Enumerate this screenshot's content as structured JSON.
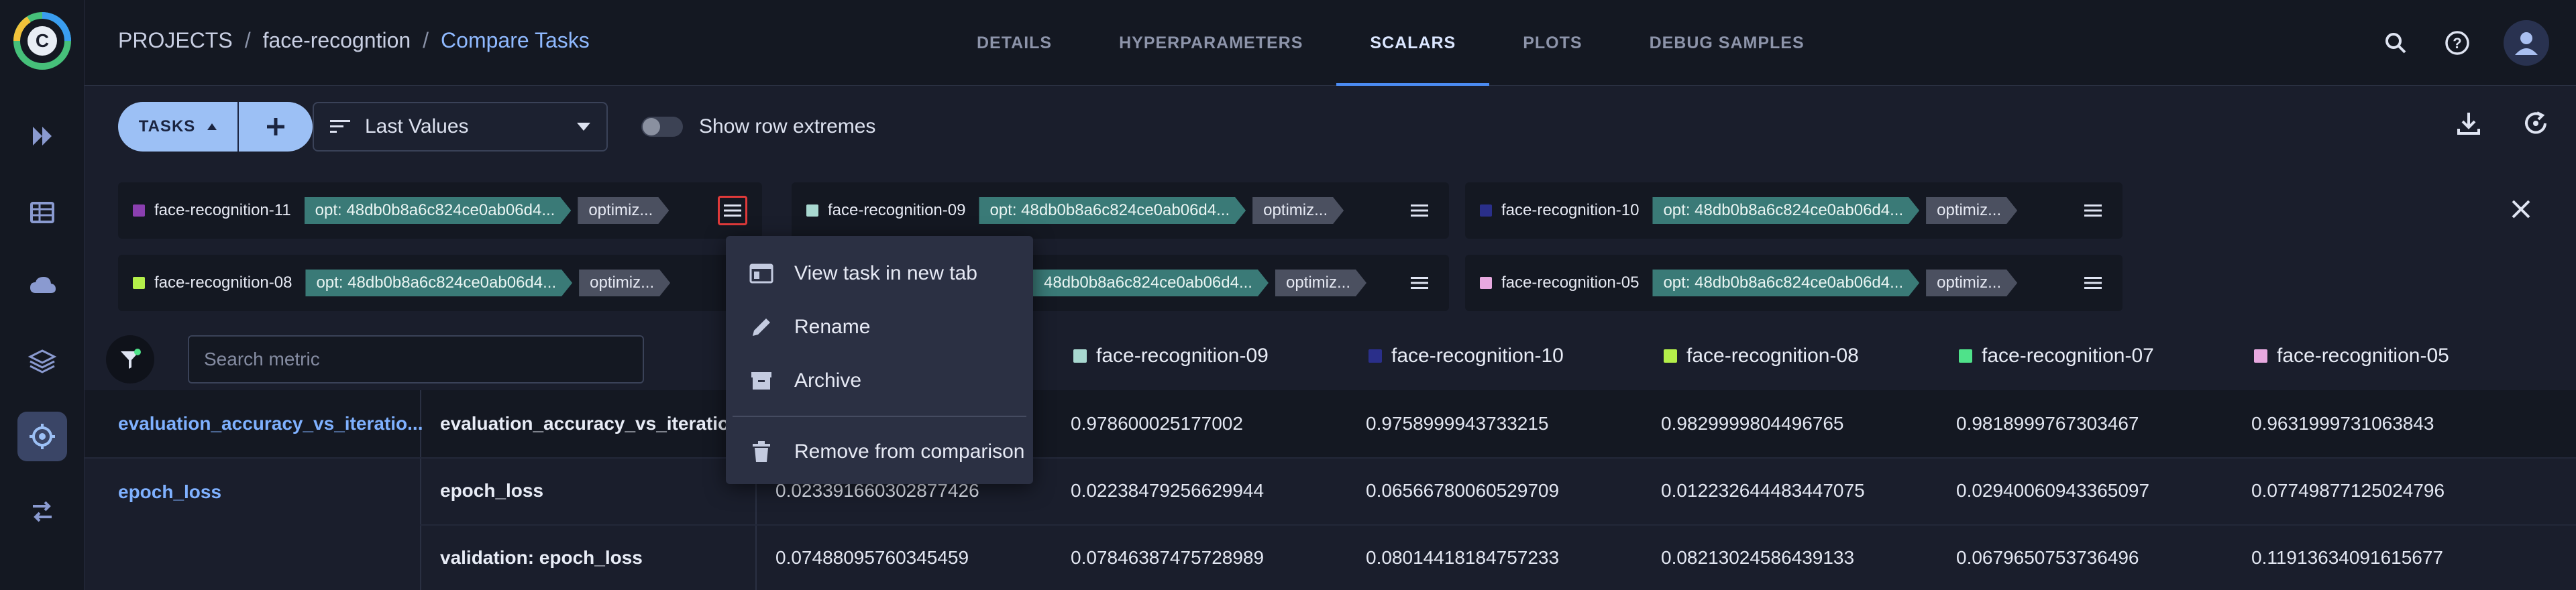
{
  "breadcrumb": {
    "projects": "PROJECTS",
    "project": "face-recogntion",
    "current": "Compare Tasks",
    "sep": "/"
  },
  "tabs": [
    {
      "label": "DETAILS",
      "active": false
    },
    {
      "label": "HYPERPARAMETERS",
      "active": false
    },
    {
      "label": "SCALARS",
      "active": true
    },
    {
      "label": "PLOTS",
      "active": false
    },
    {
      "label": "DEBUG SAMPLES",
      "active": false
    }
  ],
  "toolbar": {
    "tasks_label": "TASKS",
    "select_value": "Last Values",
    "toggle_label": "Show row extremes"
  },
  "tasks": [
    {
      "name": "face-recognition-11",
      "color": "#8b3fb0",
      "tag1": "opt: 48db0b8a6c824ce0ab06d4...",
      "tag2": "optimiz..."
    },
    {
      "name": "face-recognition-09",
      "color": "#a8d8d0",
      "tag1": "opt: 48db0b8a6c824ce0ab06d4...",
      "tag2": "optimiz..."
    },
    {
      "name": "face-recognition-10",
      "color": "#2a2f8a",
      "tag1": "opt: 48db0b8a6c824ce0ab06d4...",
      "tag2": "optimiz..."
    },
    {
      "name": "face-recognition-08",
      "color": "#b4ef4a",
      "tag1": "opt: 48db0b8a6c824ce0ab06d4...",
      "tag2": "optimiz..."
    },
    {
      "name": "",
      "color": "",
      "tag1": "48db0b8a6c824ce0ab06d4...",
      "tag2": "optimiz..."
    },
    {
      "name": "face-recognition-05",
      "color": "#e8a9e0",
      "tag1": "opt: 48db0b8a6c824ce0ab06d4...",
      "tag2": "optimiz..."
    }
  ],
  "search": {
    "placeholder": "Search metric"
  },
  "columns": [
    {
      "name": "face-recognition-09",
      "color": "#a8d8d0"
    },
    {
      "name": "face-recognition-10",
      "color": "#2a2f8a"
    },
    {
      "name": "face-recognition-08",
      "color": "#b4ef4a"
    },
    {
      "name": "face-recognition-07",
      "color": "#4fe28a"
    },
    {
      "name": "face-recognition-05",
      "color": "#e8a9e0"
    }
  ],
  "rows": [
    {
      "group": "evaluation_accuracy_vs_iteratio...",
      "metric": "evaluation_accuracy_vs_iterations",
      "first": "",
      "values": [
        "0.978600025177002",
        "0.9758999943733215",
        "0.9829999804496765",
        "0.9818999767303467",
        "0.9631999731063843"
      ]
    },
    {
      "group": "epoch_loss",
      "metric": "epoch_loss",
      "first": "0.023391660302877426",
      "values": [
        "0.02238479256629944",
        "0.06566780060529709",
        "0.012232644483447075",
        "0.02940060943365097",
        "0.07749877125024796"
      ]
    },
    {
      "group": "",
      "metric": "validation: epoch_loss",
      "first": "0.07488095760345459",
      "values": [
        "0.07846387475728989",
        "0.08014418184757233",
        "0.08213024586439133",
        "0.0679650753736496",
        "0.11913634091615677"
      ]
    }
  ],
  "context_menu": {
    "view": "View task in new tab",
    "rename": "Rename",
    "archive": "Archive",
    "remove": "Remove from comparison"
  }
}
